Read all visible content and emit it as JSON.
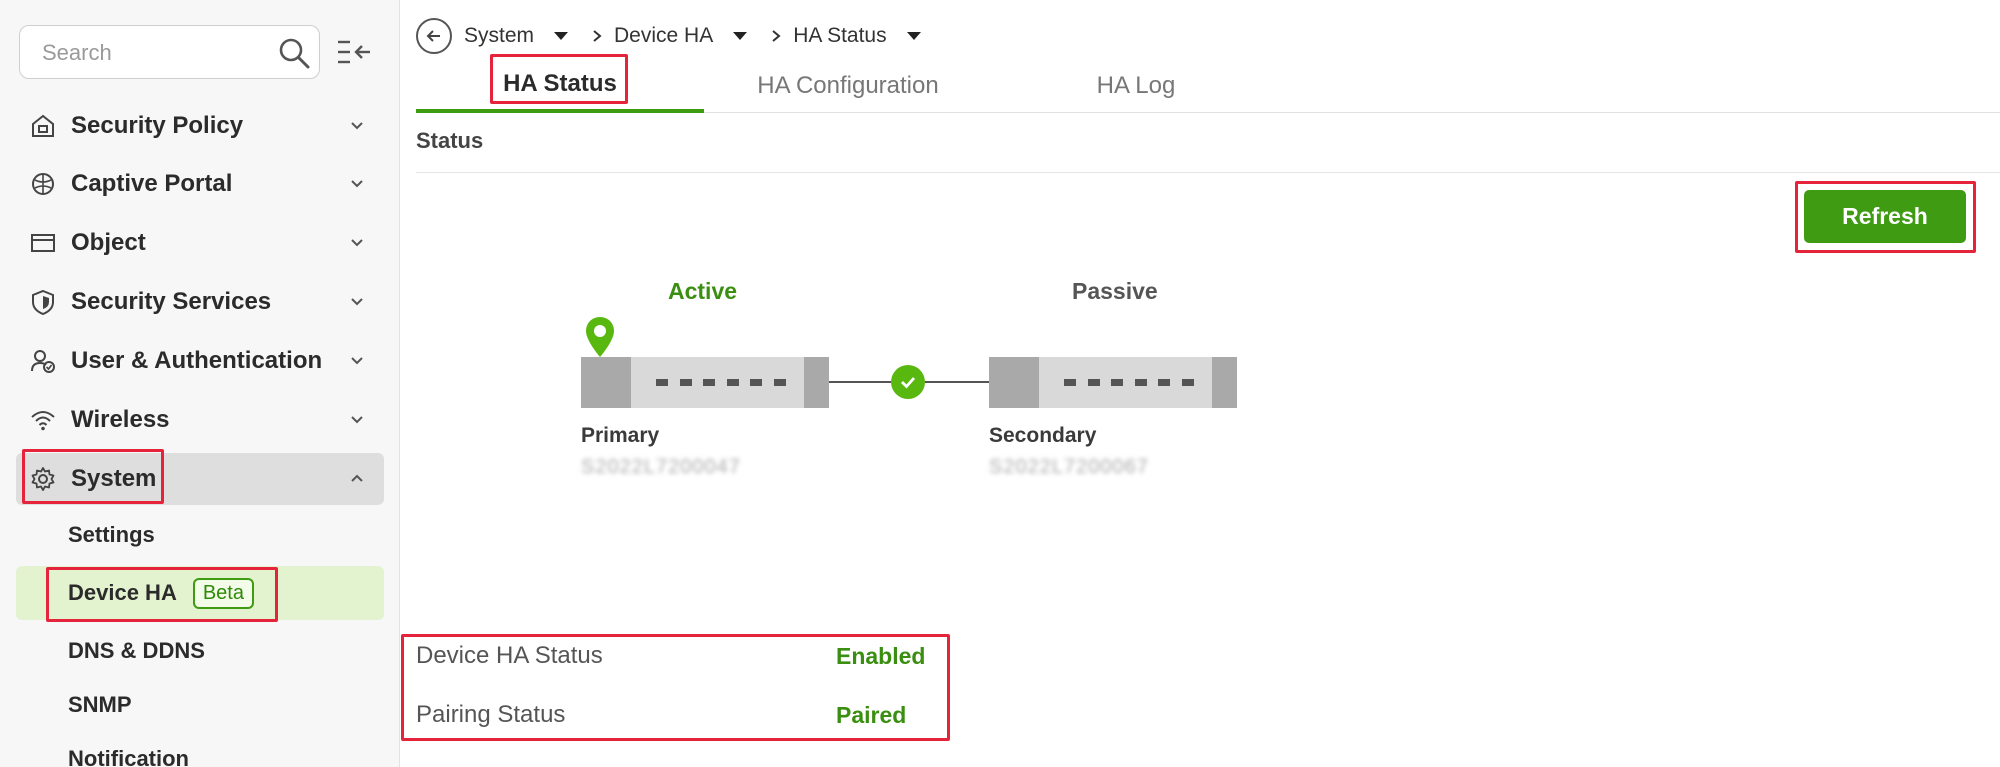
{
  "sidebar": {
    "search": {
      "placeholder": "Search"
    },
    "items": [
      {
        "label": "Security Policy",
        "icon": "security-policy-icon"
      },
      {
        "label": "Captive Portal",
        "icon": "captive-portal-icon"
      },
      {
        "label": "Object",
        "icon": "object-icon"
      },
      {
        "label": "Security Services",
        "icon": "shield-icon"
      },
      {
        "label": "User & Authentication",
        "icon": "user-auth-icon"
      },
      {
        "label": "Wireless",
        "icon": "wifi-icon"
      },
      {
        "label": "System",
        "icon": "gear-icon",
        "expanded": true
      }
    ],
    "system_subitems": [
      {
        "label": "Settings"
      },
      {
        "label": "Device HA",
        "badge": "Beta",
        "active": true
      },
      {
        "label": "DNS & DDNS"
      },
      {
        "label": "SNMP"
      },
      {
        "label": "Notification"
      }
    ]
  },
  "breadcrumb": {
    "items": [
      "System",
      "Device HA",
      "HA Status"
    ]
  },
  "tabs": [
    {
      "label": "HA Status",
      "active": true
    },
    {
      "label": "HA Configuration"
    },
    {
      "label": "HA Log"
    }
  ],
  "status_section": {
    "title": "Status",
    "refresh_label": "Refresh"
  },
  "topology": {
    "active_label": "Active",
    "passive_label": "Passive",
    "primary": {
      "role": "Primary",
      "serial": "S2022L7200047"
    },
    "secondary": {
      "role": "Secondary",
      "serial": "S2022L7200067"
    },
    "link_state": "connected"
  },
  "ha_status": [
    {
      "label": "Device HA Status",
      "value": "Enabled"
    },
    {
      "label": "Pairing Status",
      "value": "Paired"
    }
  ],
  "colors": {
    "accent": "#3f9b12",
    "highlight": "#e5233b",
    "active_bg": "#e3f2cf"
  }
}
